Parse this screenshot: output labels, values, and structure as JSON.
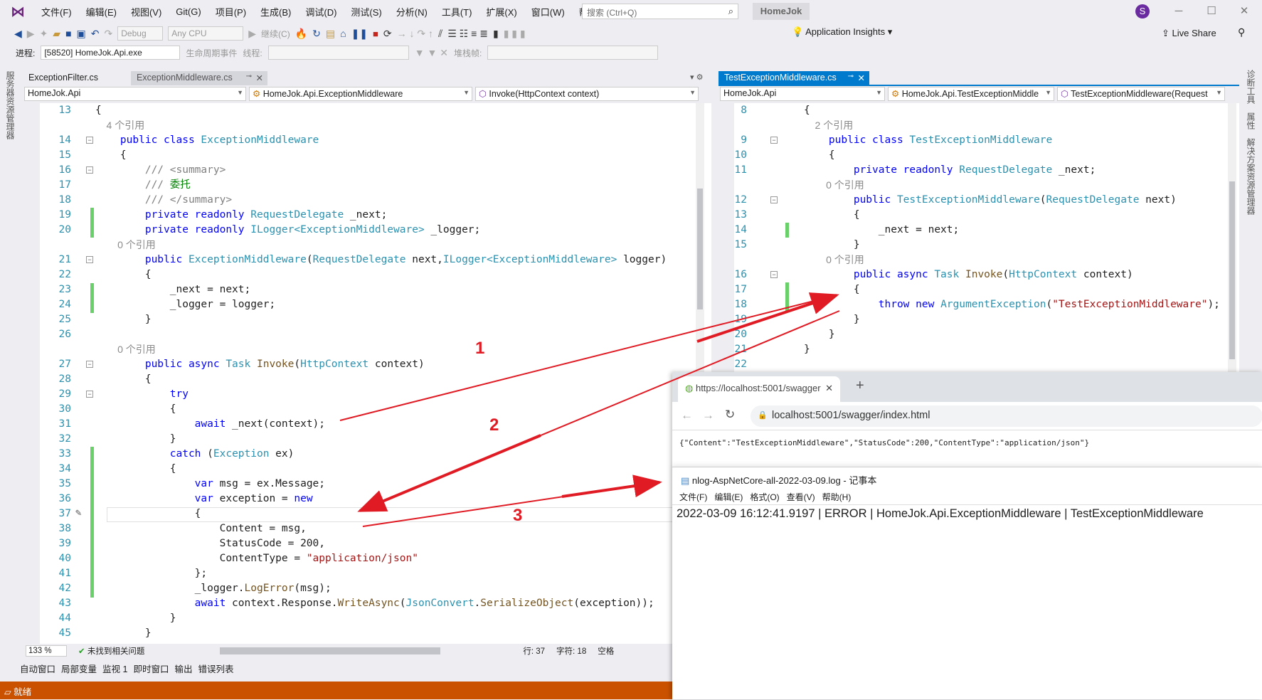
{
  "menubar": {
    "items": [
      "文件(F)",
      "编辑(E)",
      "视图(V)",
      "Git(G)",
      "项目(P)",
      "生成(B)",
      "调试(D)",
      "测试(S)",
      "分析(N)",
      "工具(T)",
      "扩展(X)",
      "窗口(W)",
      "帮助(H)"
    ],
    "search_placeholder": "搜索 (Ctrl+Q)",
    "project": "HomeJok",
    "avatar": "S"
  },
  "toolbar": {
    "config": "Debug",
    "platform": "Any CPU",
    "continue": "继续(C)",
    "app_insights": "Application Insights",
    "live_share": "Live Share"
  },
  "toolbar2": {
    "process_label": "进程:",
    "process_value": "[58520] HomeJok.Api.exe",
    "lifecycle": "生命周期事件",
    "thread_label": "线程:",
    "stackframe_label": "堆栈帧:"
  },
  "left_strip": "服务器资源管理器",
  "right_strip": [
    "诊断工具",
    "属性",
    "解决方案资源管理器"
  ],
  "left_editor": {
    "tabs": [
      "ExceptionFilter.cs",
      "ExceptionMiddleware.cs"
    ],
    "nav": [
      "HomeJok.Api",
      "HomeJok.Api.ExceptionMiddleware",
      "Invoke(HttpContext context)"
    ],
    "lines": [
      {
        "n": "13",
        "tk": [
          [
            "p",
            "{"
          ]
        ]
      },
      {
        "tk": [
          [
            "r",
            "    4 个引用"
          ]
        ]
      },
      {
        "n": "14",
        "tk": [
          [
            "k",
            "    public class "
          ],
          [
            "t",
            "ExceptionMiddleware"
          ]
        ]
      },
      {
        "n": "15",
        "tk": [
          [
            "p",
            "    {"
          ]
        ]
      },
      {
        "n": "16",
        "tk": [
          [
            "c",
            "        /// <summary>"
          ]
        ]
      },
      {
        "n": "17",
        "tk": [
          [
            "c",
            "        /// "
          ],
          [
            "cg",
            "委托"
          ]
        ]
      },
      {
        "n": "18",
        "tk": [
          [
            "c",
            "        /// </summary>"
          ]
        ]
      },
      {
        "n": "19",
        "tk": [
          [
            "k",
            "        private readonly "
          ],
          [
            "t",
            "RequestDelegate"
          ],
          [
            "p",
            " _next;"
          ]
        ]
      },
      {
        "n": "20",
        "tk": [
          [
            "k",
            "        private readonly "
          ],
          [
            "t",
            "ILogger<ExceptionMiddleware>"
          ],
          [
            "p",
            " _logger;"
          ]
        ]
      },
      {
        "tk": [
          [
            "r",
            "        0 个引用"
          ]
        ]
      },
      {
        "n": "21",
        "tk": [
          [
            "k",
            "        public "
          ],
          [
            "t",
            "ExceptionMiddleware"
          ],
          [
            "p",
            "("
          ],
          [
            "t",
            "RequestDelegate"
          ],
          [
            "p",
            " next,"
          ],
          [
            "t",
            "ILogger<ExceptionMiddleware>"
          ],
          [
            "p",
            " logger)"
          ]
        ]
      },
      {
        "n": "22",
        "tk": [
          [
            "p",
            "        {"
          ]
        ]
      },
      {
        "n": "23",
        "tk": [
          [
            "p",
            "            _next = next;"
          ]
        ]
      },
      {
        "n": "24",
        "tk": [
          [
            "p",
            "            _logger = logger;"
          ]
        ]
      },
      {
        "n": "25",
        "tk": [
          [
            "p",
            "        }"
          ]
        ]
      },
      {
        "n": "26",
        "tk": [
          [
            "p",
            ""
          ]
        ]
      },
      {
        "tk": [
          [
            "r",
            "        0 个引用"
          ]
        ]
      },
      {
        "n": "27",
        "tk": [
          [
            "k",
            "        public async "
          ],
          [
            "t",
            "Task"
          ],
          [
            "m",
            " Invoke"
          ],
          [
            "p",
            "("
          ],
          [
            "t",
            "HttpContext"
          ],
          [
            "p",
            " context)"
          ]
        ]
      },
      {
        "n": "28",
        "tk": [
          [
            "p",
            "        {"
          ]
        ]
      },
      {
        "n": "29",
        "tk": [
          [
            "k",
            "            try"
          ]
        ]
      },
      {
        "n": "30",
        "tk": [
          [
            "p",
            "            {"
          ]
        ]
      },
      {
        "n": "31",
        "tk": [
          [
            "k",
            "                await"
          ],
          [
            "p",
            " _next(context);"
          ]
        ]
      },
      {
        "n": "32",
        "tk": [
          [
            "p",
            "            }"
          ]
        ]
      },
      {
        "n": "33",
        "tk": [
          [
            "k",
            "            catch"
          ],
          [
            "p",
            " ("
          ],
          [
            "t",
            "Exception"
          ],
          [
            "p",
            " ex)"
          ]
        ]
      },
      {
        "n": "34",
        "tk": [
          [
            "p",
            "            {"
          ]
        ]
      },
      {
        "n": "35",
        "tk": [
          [
            "k",
            "                var"
          ],
          [
            "p",
            " msg = ex.Message;"
          ]
        ]
      },
      {
        "n": "36",
        "tk": [
          [
            "k",
            "                var"
          ],
          [
            "p",
            " exception = "
          ],
          [
            "k",
            "new"
          ]
        ]
      },
      {
        "n": "37",
        "tk": [
          [
            "p",
            "                {"
          ]
        ]
      },
      {
        "n": "38",
        "tk": [
          [
            "p",
            "                    Content = msg,"
          ]
        ]
      },
      {
        "n": "39",
        "tk": [
          [
            "p",
            "                    StatusCode = 200,"
          ]
        ]
      },
      {
        "n": "40",
        "tk": [
          [
            "p",
            "                    ContentType = "
          ],
          [
            "s",
            "\"application/json\""
          ]
        ]
      },
      {
        "n": "41",
        "tk": [
          [
            "p",
            "                };"
          ]
        ]
      },
      {
        "n": "42",
        "tk": [
          [
            "p",
            "                _logger."
          ],
          [
            "m",
            "LogError"
          ],
          [
            "p",
            "(msg);"
          ]
        ]
      },
      {
        "n": "43",
        "tk": [
          [
            "k",
            "                await"
          ],
          [
            "p",
            " context.Response."
          ],
          [
            "m",
            "WriteAsync"
          ],
          [
            "p",
            "("
          ],
          [
            "t",
            "JsonConvert"
          ],
          [
            "p",
            "."
          ],
          [
            "m",
            "SerializeObject"
          ],
          [
            "p",
            "(exception));"
          ]
        ]
      },
      {
        "n": "44",
        "tk": [
          [
            "p",
            "            }"
          ]
        ]
      },
      {
        "n": "45",
        "tk": [
          [
            "p",
            "        }"
          ]
        ]
      }
    ]
  },
  "right_editor": {
    "tab": "TestExceptionMiddleware.cs",
    "nav": [
      "HomeJok.Api",
      "HomeJok.Api.TestExceptionMiddle",
      "TestExceptionMiddleware(Request"
    ],
    "lines": [
      {
        "n": "8",
        "tk": [
          [
            "p",
            "{"
          ]
        ]
      },
      {
        "tk": [
          [
            "r",
            "    2 个引用"
          ]
        ]
      },
      {
        "n": "9",
        "tk": [
          [
            "k",
            "    public class "
          ],
          [
            "t",
            "TestExceptionMiddleware"
          ]
        ]
      },
      {
        "n": "10",
        "tk": [
          [
            "p",
            "    {"
          ]
        ]
      },
      {
        "n": "11",
        "tk": [
          [
            "k",
            "        private readonly "
          ],
          [
            "t",
            "RequestDelegate"
          ],
          [
            "p",
            " _next;"
          ]
        ]
      },
      {
        "tk": [
          [
            "r",
            "        0 个引用"
          ]
        ]
      },
      {
        "n": "12",
        "tk": [
          [
            "k",
            "        public "
          ],
          [
            "t",
            "TestExceptionMiddleware"
          ],
          [
            "p",
            "("
          ],
          [
            "t",
            "RequestDelegate"
          ],
          [
            "p",
            " next)"
          ]
        ]
      },
      {
        "n": "13",
        "tk": [
          [
            "p",
            "        {"
          ]
        ]
      },
      {
        "n": "14",
        "tk": [
          [
            "p",
            "            _next = next;"
          ]
        ]
      },
      {
        "n": "15",
        "tk": [
          [
            "p",
            "        }"
          ]
        ]
      },
      {
        "tk": [
          [
            "r",
            "        0 个引用"
          ]
        ]
      },
      {
        "n": "16",
        "tk": [
          [
            "k",
            "        public async "
          ],
          [
            "t",
            "Task"
          ],
          [
            "m",
            " Invoke"
          ],
          [
            "p",
            "("
          ],
          [
            "t",
            "HttpContext"
          ],
          [
            "p",
            " context)"
          ]
        ]
      },
      {
        "n": "17",
        "tk": [
          [
            "p",
            "        {"
          ]
        ]
      },
      {
        "n": "18",
        "tk": [
          [
            "k",
            "            throw new "
          ],
          [
            "t",
            "ArgumentException"
          ],
          [
            "p",
            "("
          ],
          [
            "s",
            "\"TestExceptionMiddleware\""
          ],
          [
            "p",
            ");"
          ]
        ]
      },
      {
        "n": "19",
        "tk": [
          [
            "p",
            "        }"
          ]
        ]
      },
      {
        "n": "20",
        "tk": [
          [
            "p",
            "    }"
          ]
        ]
      },
      {
        "n": "21",
        "tk": [
          [
            "p",
            "}"
          ]
        ]
      },
      {
        "n": "22",
        "tk": [
          [
            "p",
            ""
          ]
        ]
      }
    ]
  },
  "editor_status": {
    "zoom": "133 %",
    "issues": "未找到相关问题",
    "line": "行: 37",
    "char": "字符: 18",
    "space": "空格"
  },
  "bottom_tabs": [
    "自动窗口",
    "局部变量",
    "监视 1",
    "即时窗口",
    "输出",
    "错误列表"
  ],
  "statusbar": {
    "text": "就绪",
    "color": "#ca5100"
  },
  "browser": {
    "tab_title": "https://localhost:5001/swagger",
    "url": "localhost:5001/swagger/index.html",
    "body": "{\"Content\":\"TestExceptionMiddleware\",\"StatusCode\":200,\"ContentType\":\"application/json\"}"
  },
  "notepad": {
    "title": "nlog-AspNetCore-all-2022-03-09.log - 记事本",
    "menu": [
      "文件(F)",
      "编辑(E)",
      "格式(O)",
      "查看(V)",
      "帮助(H)"
    ],
    "content": "2022-03-09 16:12:41.9197 | ERROR | HomeJok.Api.ExceptionMiddleware | TestExceptionMiddleware"
  },
  "annotations": {
    "labels": [
      "1",
      "2",
      "3"
    ],
    "color": "#e01b24"
  }
}
